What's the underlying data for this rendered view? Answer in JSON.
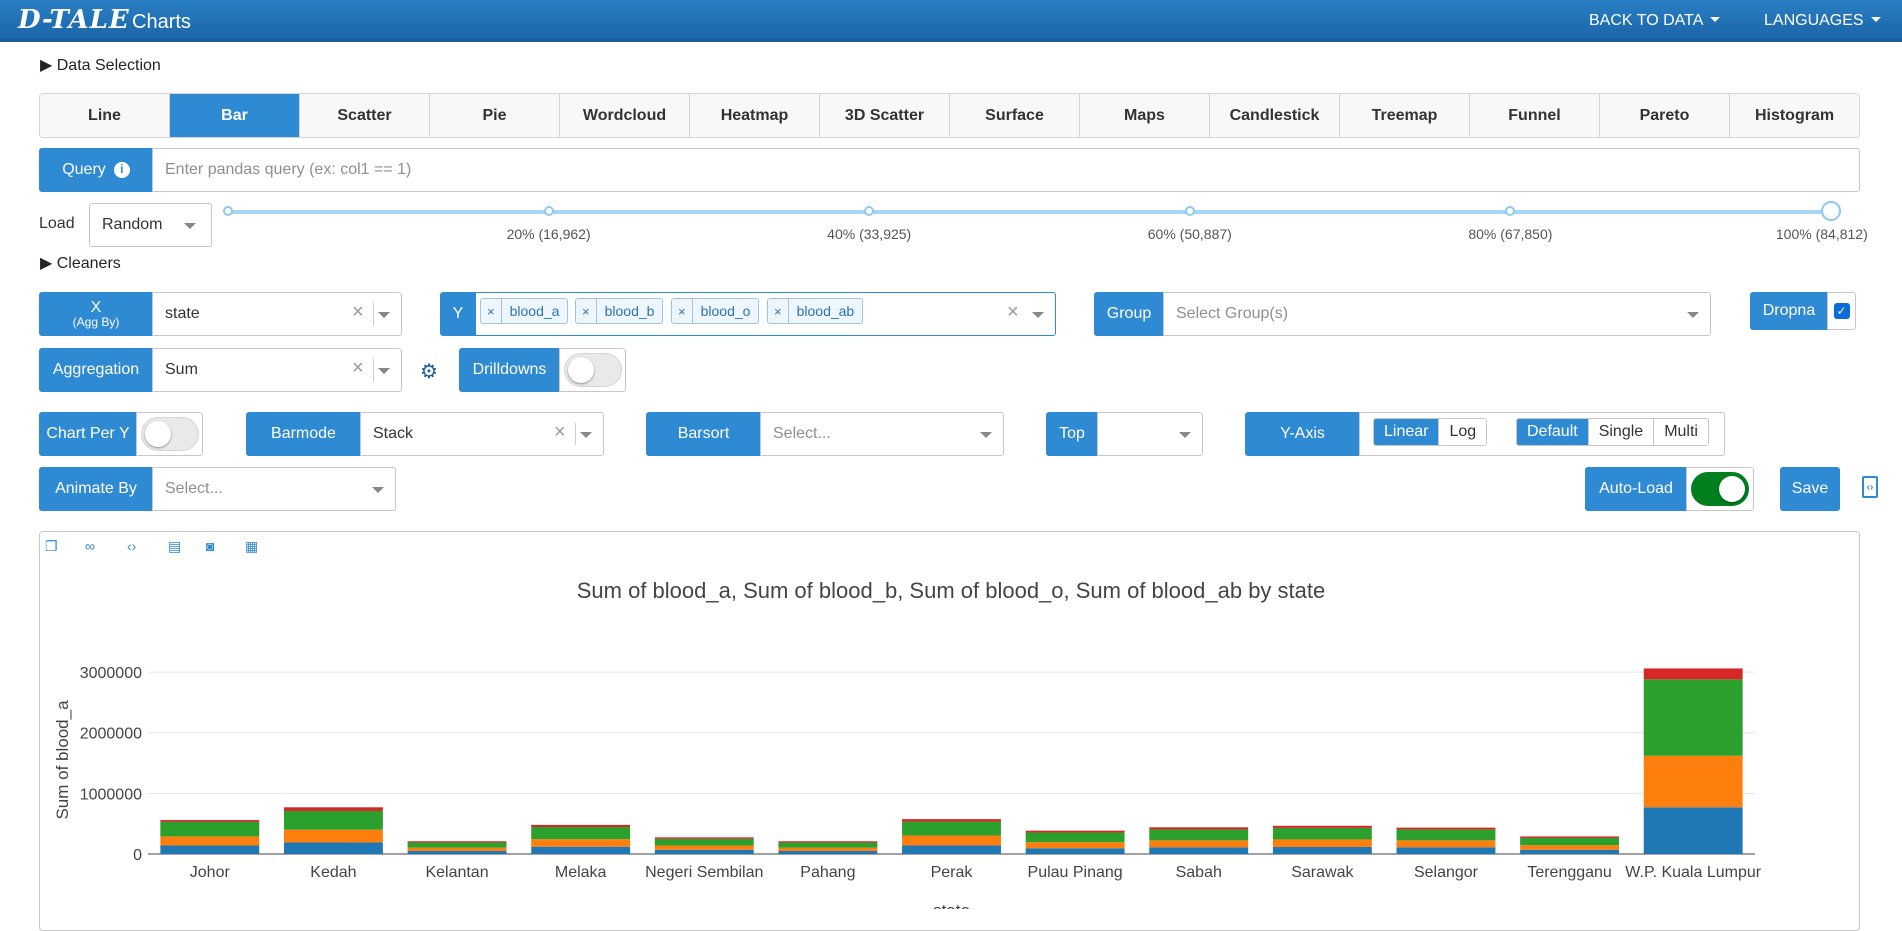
{
  "header": {
    "logo": "D-TALE",
    "title": "Charts",
    "back_to_data": "BACK TO DATA",
    "languages": "LANGUAGES"
  },
  "data_selection": "Data Selection",
  "tabs": [
    "Line",
    "Bar",
    "Scatter",
    "Pie",
    "Wordcloud",
    "Heatmap",
    "3D Scatter",
    "Surface",
    "Maps",
    "Candlestick",
    "Treemap",
    "Funnel",
    "Pareto",
    "Histogram"
  ],
  "active_tab": "Bar",
  "query": {
    "label": "Query",
    "placeholder": "Enter pandas query (ex: col1 == 1)"
  },
  "load": {
    "label": "Load",
    "value": "Random",
    "marks": [
      "20% (16,962)",
      "40% (33,925)",
      "60% (50,887)",
      "80% (67,850)",
      "100% (84,812)"
    ],
    "selected_fraction": 1.0
  },
  "cleaners": "Cleaners",
  "x": {
    "label": "X",
    "sublabel": "(Agg By)",
    "value": "state"
  },
  "y": {
    "label": "Y",
    "values": [
      "blood_a",
      "blood_b",
      "blood_o",
      "blood_ab"
    ]
  },
  "group": {
    "label": "Group",
    "placeholder": "Select Group(s)"
  },
  "dropna": {
    "label": "Dropna",
    "checked": true
  },
  "aggregation": {
    "label": "Aggregation",
    "value": "Sum"
  },
  "drilldowns": {
    "label": "Drilldowns",
    "on": false
  },
  "chart_per_y": {
    "label": "Chart Per Y",
    "on": false
  },
  "barmode": {
    "label": "Barmode",
    "value": "Stack"
  },
  "barsort": {
    "label": "Barsort",
    "placeholder": "Select..."
  },
  "top": {
    "label": "Top",
    "value": ""
  },
  "y_axis": {
    "label": "Y-Axis",
    "scale_options": [
      "Linear",
      "Log"
    ],
    "scale_selected": "Linear",
    "mode_options": [
      "Default",
      "Single",
      "Multi"
    ],
    "mode_selected": "Default"
  },
  "animate_by": {
    "label": "Animate By",
    "placeholder": "Select..."
  },
  "auto_load": {
    "label": "Auto-Load",
    "on": true
  },
  "save_label": "Save",
  "colors": {
    "accent": "#2e8ad3",
    "series": [
      "#1f77b4",
      "#ff7f0e",
      "#2ca02c",
      "#d62728"
    ]
  },
  "chart_data": {
    "type": "bar",
    "barmode": "stack",
    "title": "Sum of blood_a, Sum of blood_b, Sum of blood_o, Sum of blood_ab by state",
    "xlabel": "state",
    "ylabel": "Sum of blood_a",
    "ylim": [
      0,
      3100000
    ],
    "yticks": [
      0,
      1000000,
      2000000,
      3000000
    ],
    "categories": [
      "Johor",
      "Kedah",
      "Kelantan",
      "Melaka",
      "Negeri Sembilan",
      "Pahang",
      "Perak",
      "Pulau Pinang",
      "Sabah",
      "Sarawak",
      "Selangor",
      "Terengganu",
      "W.P. Kuala Lumpur"
    ],
    "series": [
      {
        "name": "blood_a",
        "values": [
          140000,
          190000,
          50000,
          120000,
          70000,
          50000,
          140000,
          95000,
          110000,
          115000,
          110000,
          70000,
          770000
        ]
      },
      {
        "name": "blood_b",
        "values": [
          150000,
          210000,
          55000,
          125000,
          70000,
          55000,
          165000,
          100000,
          115000,
          125000,
          115000,
          75000,
          850000
        ]
      },
      {
        "name": "blood_o",
        "values": [
          240000,
          310000,
          85000,
          200000,
          110000,
          85000,
          230000,
          160000,
          180000,
          190000,
          180000,
          120000,
          1260000
        ]
      },
      {
        "name": "blood_ab",
        "values": [
          30000,
          60000,
          20000,
          35000,
          25000,
          20000,
          40000,
          30000,
          35000,
          35000,
          30000,
          25000,
          180000
        ]
      }
    ]
  }
}
